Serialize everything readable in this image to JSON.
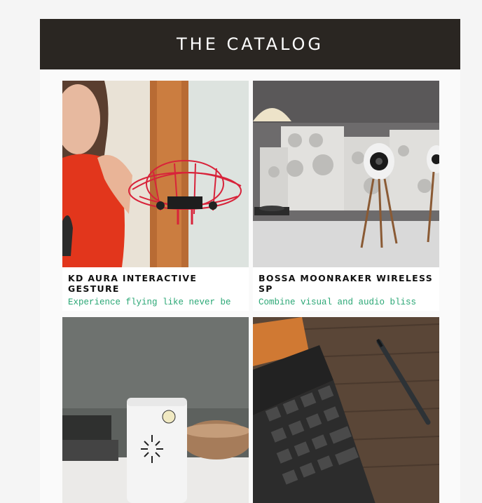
{
  "header": {
    "title": "THE CATALOG"
  },
  "products": [
    {
      "title": "KD AURA INTERACTIVE GESTURE",
      "description": "Experience flying like never be",
      "image": "drone-photo"
    },
    {
      "title": "BOSSA MOONRAKER WIRELESS SP",
      "description": "Combine visual and audio bliss",
      "image": "speaker-photo"
    },
    {
      "title": "",
      "description": "",
      "image": "white-device-photo"
    },
    {
      "title": "",
      "description": "",
      "image": "tablet-keyboard-photo"
    }
  ],
  "colors": {
    "header_bg": "#2a2622",
    "accent": "#2aa775"
  }
}
